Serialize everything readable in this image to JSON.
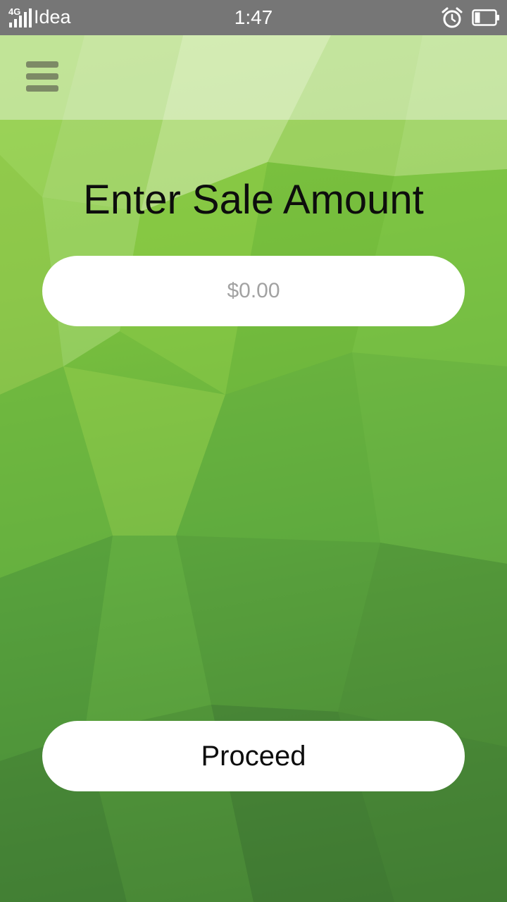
{
  "status_bar": {
    "network_type": "4G",
    "carrier": "Idea",
    "time": "1:47",
    "icons": [
      "signal-icon",
      "alarm-icon",
      "battery-icon"
    ]
  },
  "header": {
    "menu_icon": "hamburger-menu-icon"
  },
  "main": {
    "title": "Enter Sale Amount",
    "amount_placeholder": "$0.00",
    "amount_value": "",
    "proceed_label": "Proceed"
  },
  "colors": {
    "status_bar_bg": "#767676",
    "background_top": "#8fcf45",
    "background_bottom": "#3f7a32",
    "field_bg": "#ffffff",
    "menu_icon": "#7d8a66"
  }
}
